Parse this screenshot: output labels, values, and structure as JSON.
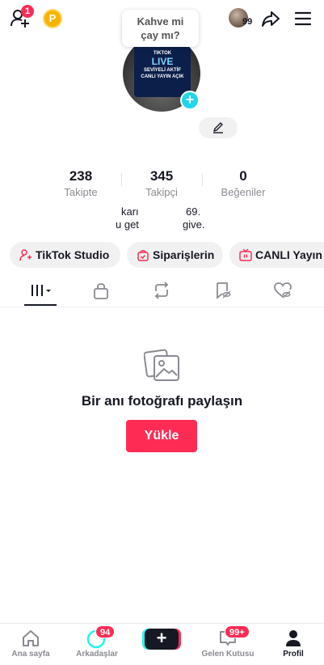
{
  "top_bar": {
    "add_friend_badge": "1",
    "coin_label": "P",
    "avatar_count": "99"
  },
  "bubble": {
    "line1": "Kahve mi",
    "line2": "çay mı?"
  },
  "profile": {
    "promo_line1": "TIKTOK",
    "promo_big": "LIVE",
    "promo_line2": "SEVİYELİ AKTİF",
    "promo_line3": "CANLI YAYIN AÇIK"
  },
  "stats": [
    {
      "value": "238",
      "label": "Takipte"
    },
    {
      "value": "345",
      "label": "Takipçi"
    },
    {
      "value": "0",
      "label": "Beğeniler"
    }
  ],
  "bio": {
    "line1_left": "karı",
    "line1_right": "69.",
    "line2_left": "u get",
    "line2_right": "give."
  },
  "pills": [
    {
      "label": "TikTok Studio"
    },
    {
      "label": "Siparişlerin"
    },
    {
      "label": "CANLI Yayın"
    }
  ],
  "empty_state": {
    "title": "Bir anı fotoğrafı paylaşın",
    "button": "Yükle"
  },
  "bottom_nav": {
    "home": "Ana sayfa",
    "friends": "Arkadaşlar",
    "friends_badge": "94",
    "create": "+",
    "inbox": "Gelen Kutusu",
    "inbox_badge": "99+",
    "profile": "Profil"
  },
  "colors": {
    "accent": "#fe2c55",
    "cyan": "#25f4ee",
    "text": "#161823",
    "muted": "#8a8b91"
  }
}
